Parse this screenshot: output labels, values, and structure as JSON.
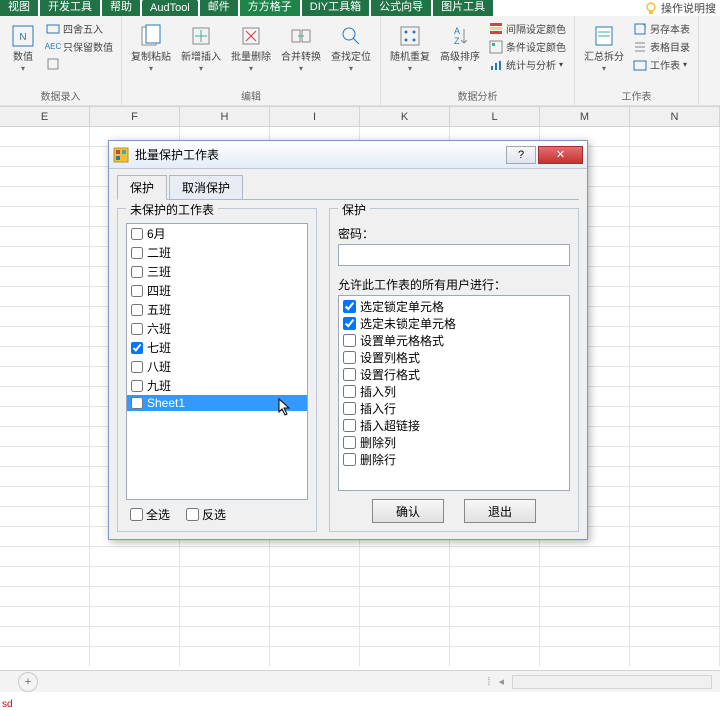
{
  "ribbon": {
    "tabs": [
      "视图",
      "开发工具",
      "帮助",
      "AudTool",
      "邮件",
      "方方格子",
      "DIY工具箱",
      "公式向导",
      "图片工具"
    ],
    "help_text": "操作说明搜",
    "groups": {
      "data_entry": {
        "label": "数据录入",
        "value_btn": "数值",
        "round": "四舍五入",
        "keep_num": "只保留数值",
        "abc": "AEC"
      },
      "edit": {
        "label": "编辑",
        "paste": "复制粘贴",
        "insert": "新增插入",
        "delete": "批量删除",
        "merge": "合并转换",
        "locate": "查找定位"
      },
      "analysis": {
        "label": "数据分析",
        "random": "随机重复",
        "sort": "高级排序",
        "alt_color": "间隔设定颜色",
        "cond_color": "条件设定颜色",
        "stats": "统计与分析"
      },
      "worksheet": {
        "label": "工作表",
        "summary": "汇总拆分",
        "save_as": "另存本表",
        "toc": "表格目录",
        "ws": "工作表"
      }
    }
  },
  "columns": [
    "E",
    "F",
    "H",
    "I",
    "K",
    "L",
    "M",
    "N"
  ],
  "dialog": {
    "title": "批量保护工作表",
    "tab_protect": "保护",
    "tab_unprotect": "取消保护",
    "left_group": "未保护的工作表",
    "right_group": "保护",
    "sheets": [
      {
        "name": "6月",
        "checked": false,
        "selected": false
      },
      {
        "name": "二班",
        "checked": false,
        "selected": false
      },
      {
        "name": "三班",
        "checked": false,
        "selected": false
      },
      {
        "name": "四班",
        "checked": false,
        "selected": false
      },
      {
        "name": "五班",
        "checked": false,
        "selected": false
      },
      {
        "name": "六班",
        "checked": false,
        "selected": false
      },
      {
        "name": "七班",
        "checked": true,
        "selected": false
      },
      {
        "name": "八班",
        "checked": false,
        "selected": false
      },
      {
        "name": "九班",
        "checked": false,
        "selected": false
      },
      {
        "name": "Sheet1",
        "checked": false,
        "selected": true
      }
    ],
    "select_all": "全选",
    "invert": "反选",
    "password_label": "密码：",
    "allow_label": "允许此工作表的所有用户进行：",
    "permissions": [
      {
        "label": "选定锁定单元格",
        "checked": true
      },
      {
        "label": "选定未锁定单元格",
        "checked": true
      },
      {
        "label": "设置单元格格式",
        "checked": false
      },
      {
        "label": "设置列格式",
        "checked": false
      },
      {
        "label": "设置行格式",
        "checked": false
      },
      {
        "label": "插入列",
        "checked": false
      },
      {
        "label": "插入行",
        "checked": false
      },
      {
        "label": "插入超链接",
        "checked": false
      },
      {
        "label": "删除列",
        "checked": false
      },
      {
        "label": "删除行",
        "checked": false
      }
    ],
    "ok": "确认",
    "cancel": "退出"
  },
  "footer": "sd"
}
